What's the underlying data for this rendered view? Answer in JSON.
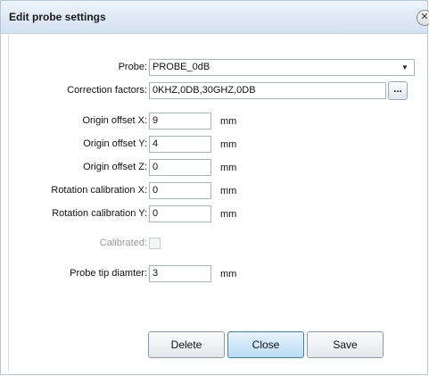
{
  "dialog": {
    "title": "Edit probe settings",
    "close_glyph": "✕"
  },
  "fields": {
    "probe": {
      "label": "Probe:",
      "value": "PROBE_0dB"
    },
    "correction": {
      "label": "Correction factors:",
      "value": "0KHZ,0DB,30GHZ,0DB",
      "button": "..."
    },
    "origin_x": {
      "label": "Origin offset X:",
      "value": "9",
      "unit": "mm"
    },
    "origin_y": {
      "label": "Origin offset Y:",
      "value": "4",
      "unit": "mm"
    },
    "origin_z": {
      "label": "Origin offset Z:",
      "value": "0",
      "unit": "mm"
    },
    "rot_x": {
      "label": "Rotation calibration X:",
      "value": "0",
      "unit": "mm"
    },
    "rot_y": {
      "label": "Rotation calibration Y:",
      "value": "0",
      "unit": "mm"
    },
    "calibrated": {
      "label": "Calibrated:",
      "checked": false
    },
    "tip": {
      "label": "Probe tip diamter:",
      "value": "3",
      "unit": "mm"
    }
  },
  "buttons": {
    "delete": "Delete",
    "close": "Close",
    "save": "Save"
  },
  "icons": {
    "dropdown": "chevron-down-icon",
    "close": "close-icon"
  }
}
